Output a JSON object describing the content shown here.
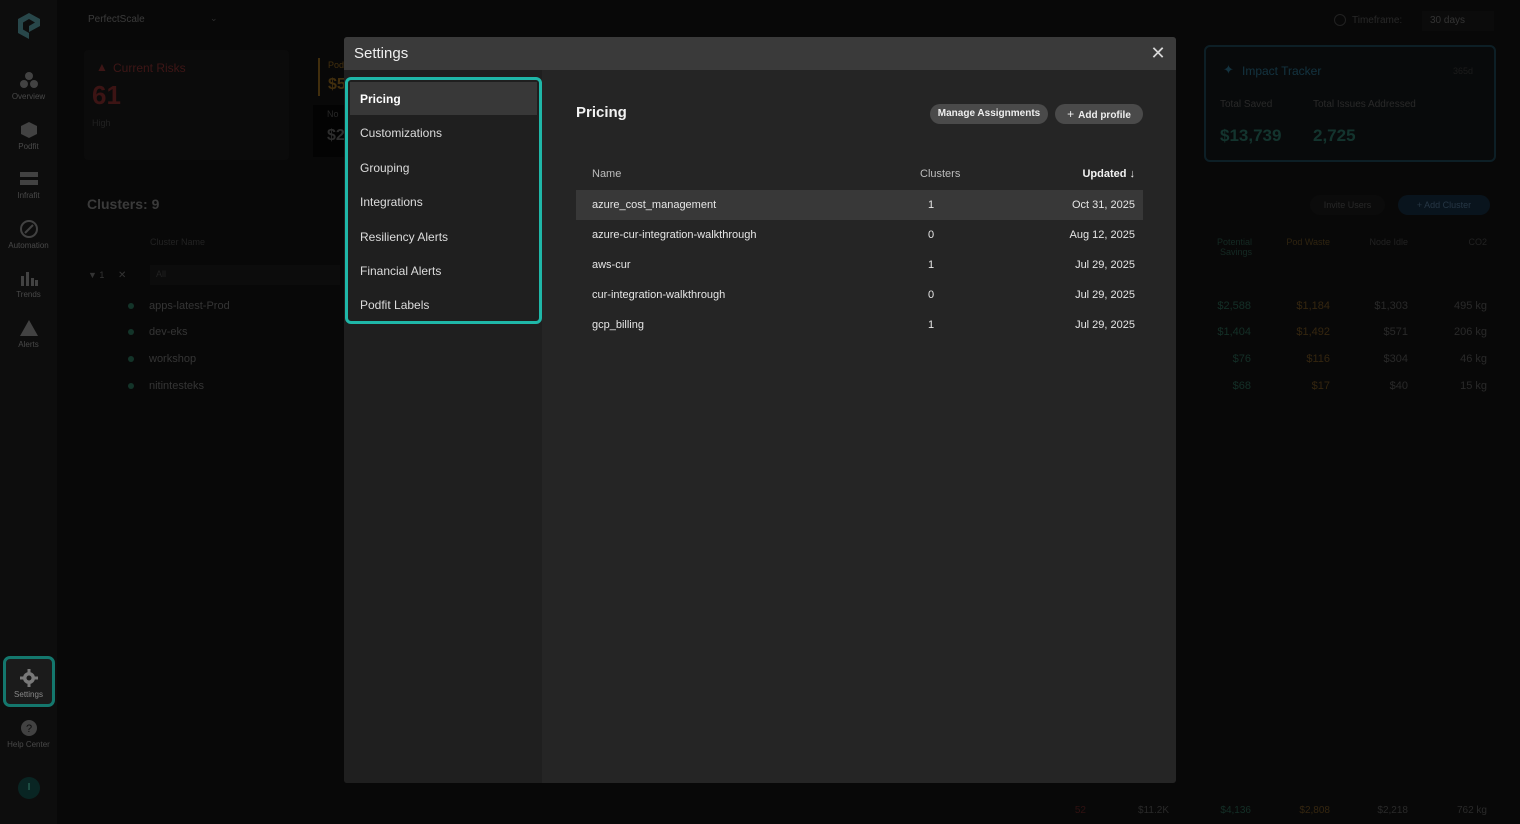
{
  "nav": {
    "items": [
      {
        "label": "Overview",
        "icon": "overview-icon"
      },
      {
        "label": "Podfit",
        "icon": "cube-icon"
      },
      {
        "label": "Infrafit",
        "icon": "server-icon"
      },
      {
        "label": "Automation",
        "icon": "automation-icon"
      },
      {
        "label": "Trends",
        "icon": "bar-chart-icon"
      },
      {
        "label": "Alerts",
        "icon": "warning-icon"
      },
      {
        "label": "Settings",
        "icon": "gear-icon"
      },
      {
        "label": "Help Center",
        "icon": "help-icon"
      }
    ],
    "avatar_initial": "I"
  },
  "background": {
    "org_name": "PerfectScale",
    "risks": {
      "title": "Current Risks",
      "value": "61",
      "sub": "High"
    },
    "pod_card": {
      "label": "Pod",
      "value": "$5"
    },
    "node_card": {
      "label": "No",
      "value": "$2"
    },
    "clusters_heading": "Clusters: 9",
    "cluster_col": "Cluster Name",
    "filter_count": "1",
    "filter_value": "All",
    "clusters": [
      "apps-latest-Prod",
      "dev-eks",
      "workshop",
      "nitintesteks"
    ],
    "timeframe_label": "Timeframe:",
    "timeframe_value": "30 days",
    "impact": {
      "title": "Impact Tracker",
      "range": "365d",
      "saved_label": "Total Saved",
      "issues_label": "Total Issues Addressed",
      "saved": "$13,739",
      "issues": "2,725"
    },
    "invite_label": "Invite Users",
    "add_cluster_label": "Add Cluster",
    "columns": [
      "Potential Savings",
      "Pod Waste",
      "Node Idle",
      "CO2"
    ],
    "rows": [
      [
        "$2,588",
        "$1,184",
        "$1,303",
        "495 kg"
      ],
      [
        "$1,404",
        "$1,492",
        "$571",
        "206 kg"
      ],
      [
        "$76",
        "$116",
        "$304",
        "46 kg"
      ],
      [
        "$68",
        "$17",
        "$40",
        "15 kg"
      ]
    ],
    "footer": [
      "52",
      "$11.2K",
      "$4,136",
      "$2,808",
      "$2,218",
      "762 kg"
    ]
  },
  "modal": {
    "title": "Settings",
    "menu": [
      "Pricing",
      "Customizations",
      "Grouping",
      "Integrations",
      "Resiliency Alerts",
      "Financial Alerts",
      "Podfit Labels"
    ],
    "content_title": "Pricing",
    "manage_label": "Manage Assignments",
    "add_profile_label": "Add profile",
    "columns": {
      "name": "Name",
      "clusters": "Clusters",
      "updated": "Updated ↓"
    },
    "rows": [
      {
        "name": "azure_cost_management",
        "clusters": "1",
        "updated": "Oct 31, 2025"
      },
      {
        "name": "azure-cur-integration-walkthrough",
        "clusters": "0",
        "updated": "Aug 12, 2025"
      },
      {
        "name": "aws-cur",
        "clusters": "1",
        "updated": "Jul 29, 2025"
      },
      {
        "name": "cur-integration-walkthrough",
        "clusters": "0",
        "updated": "Jul 29, 2025"
      },
      {
        "name": "gcp_billing",
        "clusters": "1",
        "updated": "Jul 29, 2025"
      }
    ]
  },
  "colors": {
    "accent": "#1fb7a8",
    "modal_bg": "#252525",
    "header_bg": "#3a3a3a"
  }
}
